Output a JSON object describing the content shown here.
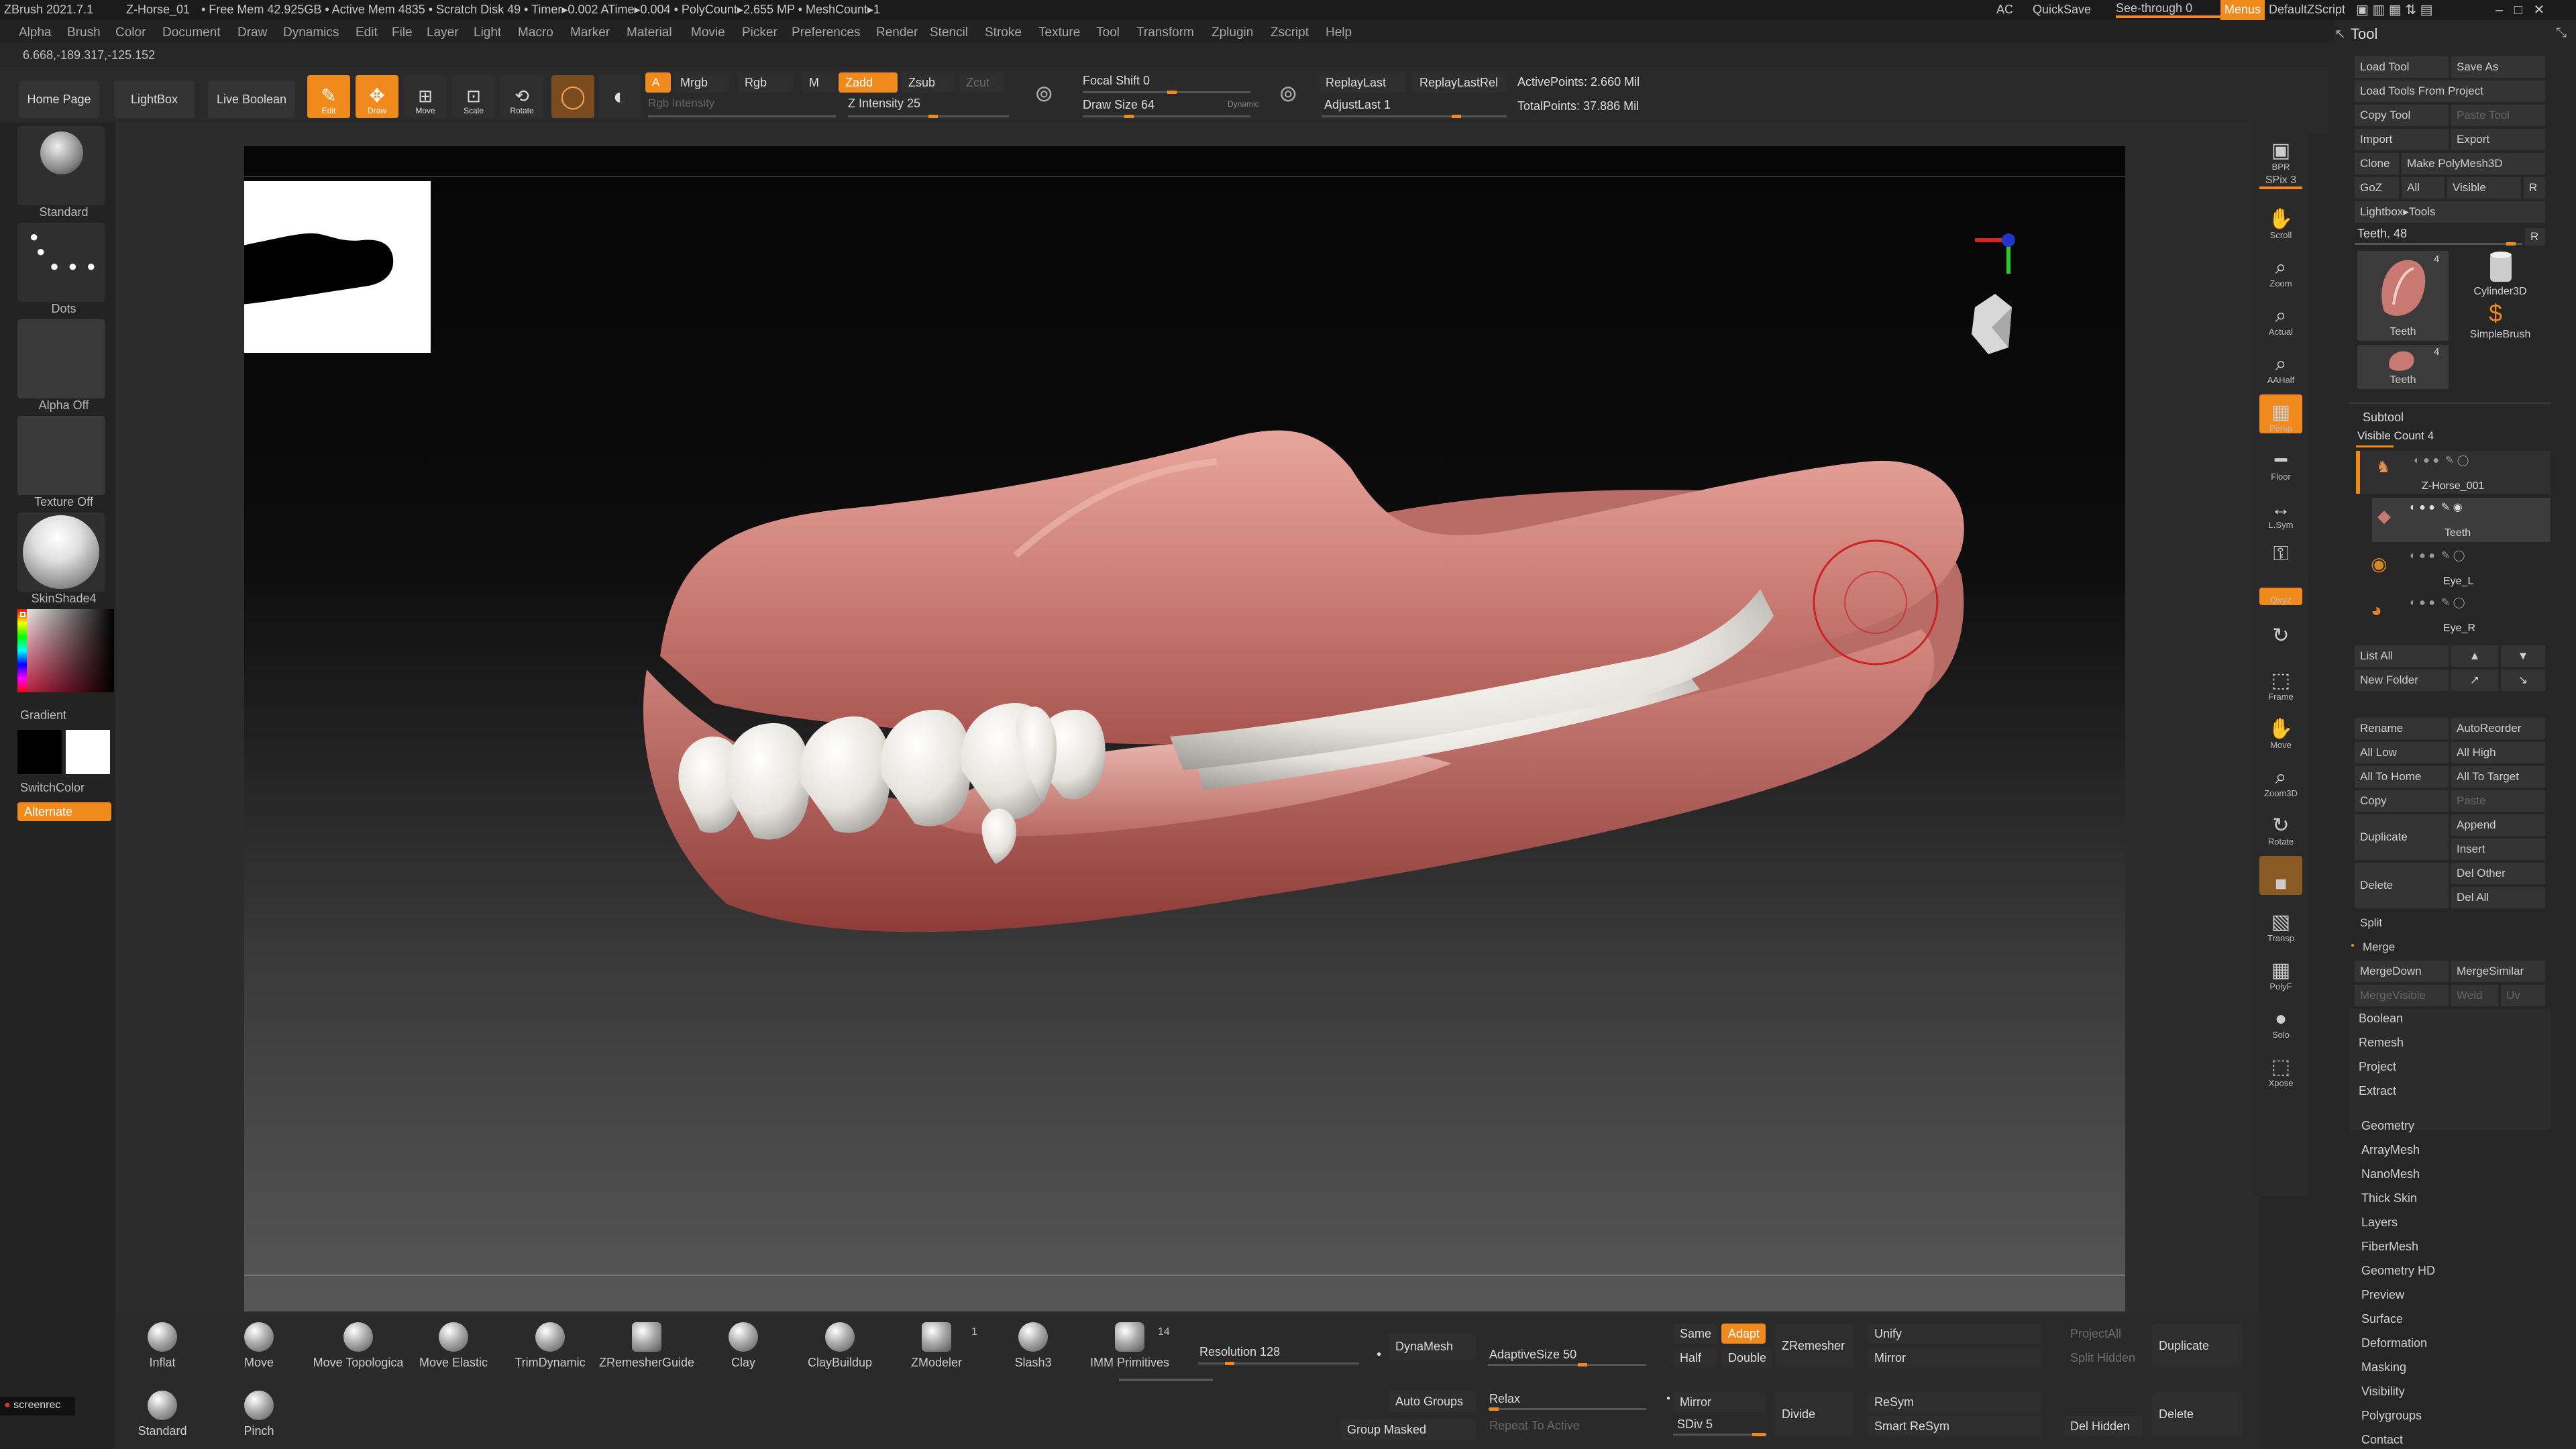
{
  "titlebar": {
    "app": "ZBrush 2021.7.1",
    "project": "Z-Horse_01",
    "stats": "• Free Mem 42.925GB • Active Mem 4835 • Scratch Disk 49 • Timer▸0.002 ATime▸0.004 • PolyCount▸2.655 MP • MeshCount▸1",
    "ac": "AC",
    "quicksave": "QuickSave",
    "seethrough": "See-through  0",
    "menus": "Menus",
    "script": "DefaultZScript"
  },
  "menubar": [
    "Alpha",
    "Brush",
    "Color",
    "Document",
    "Draw",
    "Dynamics",
    "Edit",
    "File",
    "Layer",
    "Light",
    "Macro",
    "Marker",
    "Material",
    "Movie",
    "Picker",
    "Preferences",
    "Render",
    "Stencil",
    "Stroke",
    "Texture",
    "Tool",
    "Transform",
    "Zplugin",
    "Zscript",
    "Help"
  ],
  "coords": "6.668,-189.317,-125.152",
  "topshelf": {
    "homepage": "Home Page",
    "lightbox": "LightBox",
    "liveboolean": "Live Boolean",
    "edit": "Edit",
    "draw": "Draw",
    "move": "Move",
    "scale": "Scale",
    "rotate": "Rotate",
    "a": "A",
    "mrgb": "Mrgb",
    "rgb": "Rgb",
    "m": "M",
    "rgb_intensity": "Rgb Intensity",
    "zadd": "Zadd",
    "zsub": "Zsub",
    "zcut": "Zcut",
    "z_intensity": "Z Intensity 25",
    "focal_shift": "Focal Shift 0",
    "draw_size": "Draw Size 64",
    "dynamic": "Dynamic",
    "replaylast": "ReplayLast",
    "replaylastrel": "ReplayLastRel",
    "adjustlast": "AdjustLast 1",
    "activepoints": "ActivePoints: 2.660 Mil",
    "totalpoints": "TotalPoints: 37.886 Mil"
  },
  "lefttray": {
    "standard": "Standard",
    "dots": "Dots",
    "alpha_off": "Alpha Off",
    "texture_off": "Texture Off",
    "material": "SkinShade4",
    "gradient": "Gradient",
    "switchcolor": "SwitchColor",
    "alternate": "Alternate"
  },
  "rightshelf": [
    {
      "label": "BPR",
      "icon": "▣"
    },
    {
      "label": "SPix 3",
      "icon": ""
    },
    {
      "label": "Scroll",
      "icon": "✋"
    },
    {
      "label": "Zoom",
      "icon": "⌕"
    },
    {
      "label": "Actual",
      "icon": "⌕"
    },
    {
      "label": "AAHalf",
      "icon": "⌕"
    },
    {
      "label": "Persp",
      "icon": "▦"
    },
    {
      "label": "Floor",
      "icon": "━"
    },
    {
      "label": "L.Sym",
      "icon": "↔"
    },
    {
      "label": "",
      "icon": "⚿"
    },
    {
      "label": "Qxyz",
      "icon": ""
    },
    {
      "label": "",
      "icon": "↻"
    },
    {
      "label": "Frame",
      "icon": "⬚"
    },
    {
      "label": "Move",
      "icon": "✋"
    },
    {
      "label": "Zoom3D",
      "icon": "⌕"
    },
    {
      "label": "Rotate",
      "icon": "↻"
    },
    {
      "label": "",
      "icon": "■"
    },
    {
      "label": "Transp",
      "icon": "▧"
    },
    {
      "label": "PolyF",
      "icon": "▦"
    },
    {
      "label": "Solo",
      "icon": "●"
    },
    {
      "label": "Xpose",
      "icon": "⬚"
    }
  ],
  "toolpanel": {
    "title": "Tool",
    "load_tool": "Load Tool",
    "save_as": "Save As",
    "load_from_project": "Load Tools From Project",
    "copy_tool": "Copy Tool",
    "paste_tool": "Paste Tool",
    "import": "Import",
    "export": "Export",
    "clone": "Clone",
    "make_polymesh": "Make PolyMesh3D",
    "goz": "GoZ",
    "all": "All",
    "visible": "Visible",
    "r": "R",
    "lightbox_tools": "Lightbox▸Tools",
    "teeth_slider": "Teeth. 48",
    "tools": [
      {
        "label": "Teeth",
        "count": "4"
      },
      {
        "label": "Cylinder3D",
        "count": ""
      },
      {
        "label": "SimpleBrush",
        "count": ""
      },
      {
        "label": "Teeth",
        "count": "4"
      }
    ],
    "subtool_header": "Subtool",
    "visible_count": "Visible Count 4",
    "subtools": [
      "Z-Horse_001",
      "Teeth",
      "Eye_L",
      "Eye_R"
    ],
    "list_all": "List All",
    "new_folder": "New Folder",
    "rename": "Rename",
    "autoreorder": "AutoReorder",
    "all_low": "All Low",
    "all_high": "All High",
    "all_to_home": "All To Home",
    "all_to_target": "All To Target",
    "copy": "Copy",
    "paste": "Paste",
    "duplicate": "Duplicate",
    "append": "Append",
    "insert": "Insert",
    "delete": "Delete",
    "del_other": "Del Other",
    "del_all": "Del All",
    "split": "Split",
    "merge": "Merge",
    "mergedown": "MergeDown",
    "mergesimilar": "MergeSimilar",
    "mergevisible": "MergeVisible",
    "weld": "Weld",
    "uv": "Uv",
    "sections": [
      "Boolean",
      "Remesh",
      "Project",
      "Extract"
    ],
    "subpalettes": [
      "Geometry",
      "ArrayMesh",
      "NanoMesh",
      "Thick Skin",
      "Layers",
      "FiberMesh",
      "Geometry HD",
      "Preview",
      "Surface",
      "Deformation",
      "Masking",
      "Visibility",
      "Polygroups",
      "Contact"
    ]
  },
  "bottom": {
    "brushes": [
      "Inflat",
      "Move",
      "Move Topologica",
      "Move Elastic",
      "TrimDynamic",
      "ZRemesherGuide",
      "Clay",
      "ClayBuildup",
      "ZModeler",
      "Slash3",
      "IMM Primitives"
    ],
    "zmodeler_count": "1",
    "imm_count": "14",
    "brushes2": [
      "Standard",
      "Pinch"
    ],
    "resolution": "Resolution 128",
    "dynamesh": "DynaMesh",
    "adaptivesize": "AdaptiveSize 50",
    "auto_groups": "Auto Groups",
    "relax": "Relax",
    "repeat_to_active": "Repeat To Active",
    "group_masked": "Group Masked",
    "same": "Same",
    "adapt": "Adapt",
    "half": "Half",
    "double": "Double",
    "zremesher": "ZRemesher",
    "unify": "Unify",
    "mirror_top": "Mirror",
    "mirror": "Mirror",
    "sdiv": "SDiv 5",
    "divide": "Divide",
    "resym": "ReSym",
    "smart_resym": "Smart ReSym",
    "project_all": "ProjectAll",
    "split_hidden": "Split Hidden",
    "duplicate": "Duplicate",
    "delete": "Delete",
    "del_hidden": "Del Hidden",
    "screenrec": "screenrec"
  },
  "colors": {
    "accent": "#f08a1c",
    "background": "#262626",
    "gum": "#c87a72",
    "tooth": "#ebe8e0"
  }
}
